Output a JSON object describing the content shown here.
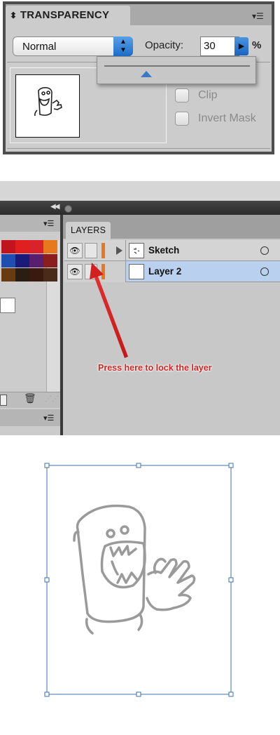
{
  "transparency_panel": {
    "tab_label": "TRANSPARENCY",
    "collapse_glyph": "⬍",
    "menu_icon": "panel-menu-icon",
    "blend_mode": {
      "selected": "Normal"
    },
    "opacity": {
      "label": "Opacity:",
      "value": "30",
      "unit": "%"
    },
    "opacity_slider_level": 30,
    "options": [
      {
        "label": "Clip",
        "checked": false
      },
      {
        "label": "Invert Mask",
        "checked": false
      }
    ]
  },
  "layers_panel": {
    "tab_label": "LAYERS",
    "layers": [
      {
        "name": "Sketch",
        "selected": false,
        "visible": true,
        "locked": false,
        "color": "#e8781e",
        "expandable": true
      },
      {
        "name": "Layer 2",
        "selected": true,
        "visible": true,
        "locked": false,
        "color": "#e8781e",
        "expandable": false
      }
    ],
    "annotation": "Press here to lock the layer",
    "annotation_color": "#d72020"
  },
  "swatches": {
    "colors": [
      "#c0141e",
      "#e01f1f",
      "#d9232a",
      "#e8781e",
      "#1e4fb0",
      "#1a1a7a",
      "#5a1e6e",
      "#8a1e1e",
      "#6a3a10",
      "#2a1e12",
      "#3a1a0e",
      "#4a2a18"
    ]
  },
  "artboard": {
    "selection_color": "#3b6fb3",
    "sketch_stroke_color": "#9a9a9a"
  }
}
